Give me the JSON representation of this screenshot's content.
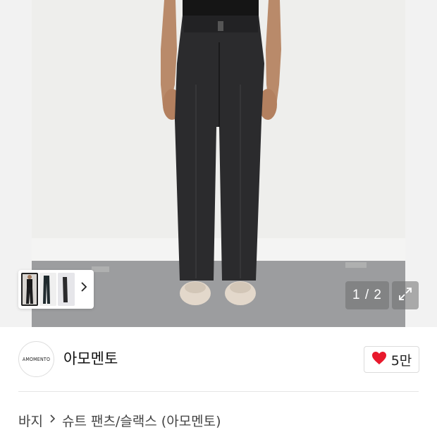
{
  "gallery": {
    "counter": "1 / 2",
    "thumbnails": [
      {
        "name": "thumb-model-front",
        "active": true
      },
      {
        "name": "thumb-pants-dark",
        "active": false
      },
      {
        "name": "thumb-pants-side",
        "active": false
      }
    ],
    "thumbs_next_icon": "chevron-right-icon",
    "expand_icon": "expand-icon"
  },
  "brand": {
    "logo_text": "AMOMENTO",
    "name": "아모멘토"
  },
  "like": {
    "icon": "heart-icon",
    "count": "5만",
    "color": "#e8192c"
  },
  "breadcrumb": {
    "category": "바지",
    "separator_icon": "chevron-right-icon",
    "subcategory": "슈트 팬츠/슬랙스 (아모멘토)"
  }
}
